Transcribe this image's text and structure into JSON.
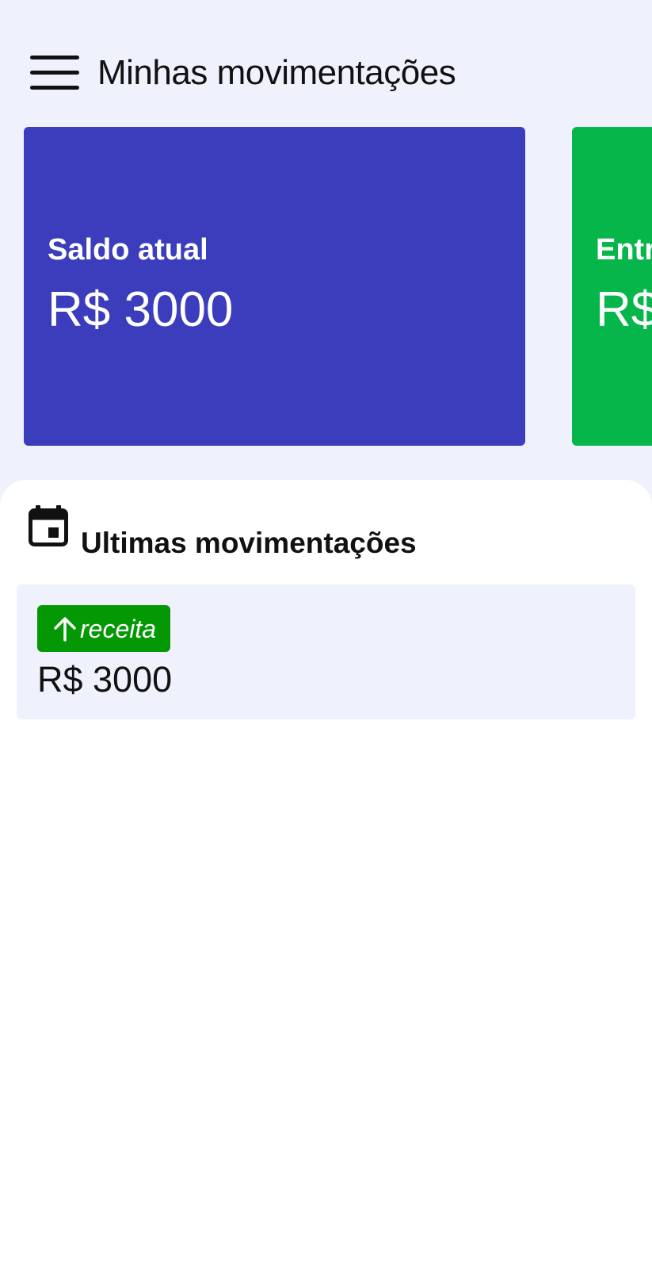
{
  "header": {
    "title": "Minhas movimentações",
    "menu_icon": "menu-icon"
  },
  "cards": [
    {
      "label": "Saldo atual",
      "value": "R$ 3000",
      "color": "#3c3dbd"
    },
    {
      "label": "Entr",
      "value": "R$",
      "color": "#06b64a"
    }
  ],
  "movements": {
    "title": "Ultimas movimentações",
    "icon": "calendar-icon",
    "items": [
      {
        "type_label": "receita",
        "type_icon": "arrow-up-icon",
        "type_color": "#059805",
        "value": "R$ 3000"
      }
    ]
  },
  "colors": {
    "background": "#eff2fd",
    "panel": "#ffffff",
    "text": "#111111"
  }
}
